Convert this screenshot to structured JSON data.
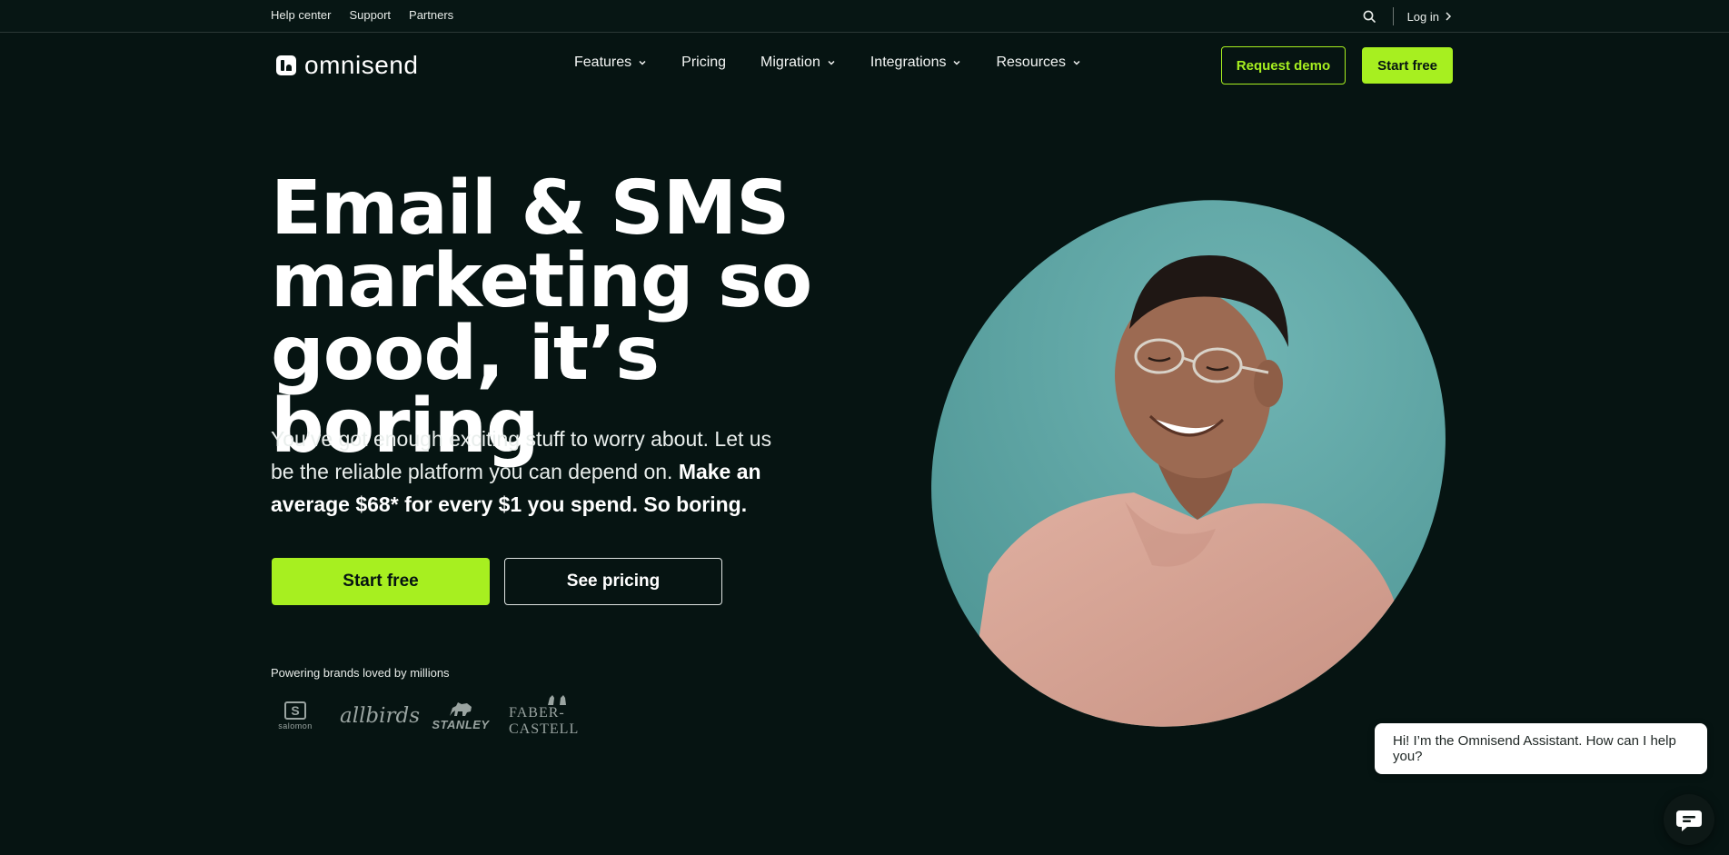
{
  "colors": {
    "background": "#061412",
    "accent_lime": "#a7ef20",
    "text": "#ffffff",
    "photo_background": "#5fa6a6",
    "sweater": "#d8a596"
  },
  "utility_bar": {
    "links": [
      "Help center",
      "Support",
      "Partners"
    ],
    "search_icon": "search-icon",
    "login_label": "Log in"
  },
  "nav": {
    "logo_text": "omnisend",
    "menu": [
      {
        "label": "Features",
        "has_dropdown": true
      },
      {
        "label": "Pricing",
        "has_dropdown": false
      },
      {
        "label": "Migration",
        "has_dropdown": true
      },
      {
        "label": "Integrations",
        "has_dropdown": true
      },
      {
        "label": "Resources",
        "has_dropdown": true
      }
    ],
    "request_demo_label": "Request demo",
    "start_free_label": "Start free"
  },
  "hero": {
    "title_lines": [
      "Email & SMS",
      "marketing so",
      "good, it’s boring"
    ],
    "subtitle_regular": "You’ve got enough exciting stuff to worry about. Let us be the reliable platform you can depend on.",
    "subtitle_bold": "Make an average $68* for every $1 you spend. So boring.",
    "primary_cta": "Start free",
    "secondary_cta": "See pricing",
    "brands_label": "Powering brands loved by millions",
    "brands": [
      "salomon",
      "allbirds",
      "STANLEY",
      "FABER-CASTELL"
    ]
  },
  "chat": {
    "greeting": "Hi! I’m the Omnisend Assistant. How can I help you?",
    "button_icon": "chat-icon"
  }
}
